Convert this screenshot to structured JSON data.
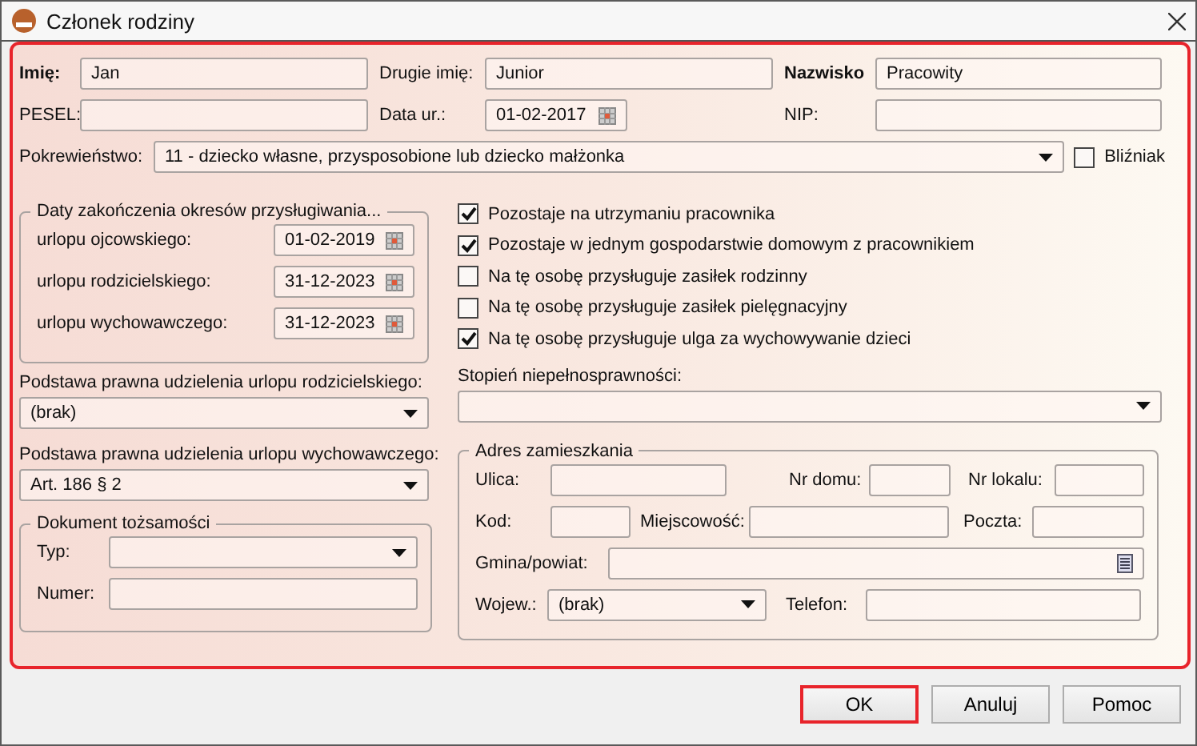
{
  "window": {
    "title": "Członek rodziny"
  },
  "form": {
    "highlighted": true
  },
  "first_name": {
    "label": "Imię:",
    "value": "Jan"
  },
  "middle_name": {
    "label": "Drugie imię:",
    "value": "Junior"
  },
  "last_name": {
    "label": "Nazwisko",
    "value": "Pracowity"
  },
  "pesel": {
    "label": "PESEL:"
  },
  "birth_date": {
    "label": "Data ur.:",
    "value": "01-02-2017"
  },
  "nip": {
    "label": "NIP:"
  },
  "relationship": {
    "label": "Pokrewieństwo:",
    "value": "11 - dziecko własne, przysposobione lub dziecko małżonka"
  },
  "twin": {
    "label": "Bliźniak",
    "checked": false
  },
  "leave_end_dates": {
    "title": "Daty zakończenia okresów przysługiwania...",
    "rows": [
      {
        "label": "urlopu ojcowskiego:",
        "value": "01-02-2019"
      },
      {
        "label": "urlopu rodzicielskiego:",
        "value": "31-12-2023"
      },
      {
        "label": "urlopu wychowawczego:",
        "value": "31-12-2023"
      }
    ]
  },
  "options": [
    {
      "label": "Pozostaje na utrzymaniu pracownika",
      "checked": true
    },
    {
      "label": "Pozostaje w jednym gospodarstwie domowym z pracownikiem",
      "checked": true
    },
    {
      "label": "Na tę osobę przysługuje zasiłek rodzinny",
      "checked": false
    },
    {
      "label": "Na tę osobę przysługuje zasiłek pielęgnacyjny",
      "checked": false
    },
    {
      "label": "Na tę osobę przysługuje ulga za wychowywanie dzieci",
      "checked": true
    }
  ],
  "parental_leave_basis": {
    "label": "Podstawa prawna udzielenia urlopu rodzicielskiego:",
    "value": "(brak)"
  },
  "childcare_leave_basis": {
    "label": "Podstawa prawna udzielenia urlopu wychowawczego:",
    "value": "Art. 186 § 2"
  },
  "id_document": {
    "title": "Dokument tożsamości",
    "fields": [
      {
        "label": "Typ:",
        "kind": "select"
      },
      {
        "label": "Numer:",
        "kind": "text"
      }
    ]
  },
  "disability": {
    "label": "Stopień niepełnosprawności:"
  },
  "address": {
    "title": "Adres zamieszkania",
    "rows": [
      [
        {
          "label": "Ulica:",
          "kind": "text"
        },
        {
          "label": "Nr domu:",
          "kind": "text"
        },
        {
          "label": "Nr lokalu:",
          "kind": "text"
        }
      ],
      [
        {
          "label": "Kod:",
          "kind": "text"
        },
        {
          "label": "Miejscowość:",
          "kind": "text"
        },
        {
          "label": "Poczta:",
          "kind": "text"
        }
      ],
      [
        {
          "label": "Gmina/powiat:",
          "kind": "picker"
        }
      ],
      [
        {
          "label": "Wojew.:",
          "kind": "select",
          "value": "(brak)"
        },
        {
          "label": "Telefon:",
          "kind": "text"
        }
      ]
    ]
  },
  "buttons": [
    {
      "label": "OK",
      "highlighted": true
    },
    {
      "label": "Anuluj",
      "highlighted": false
    },
    {
      "label": "Pomoc",
      "highlighted": false
    }
  ]
}
